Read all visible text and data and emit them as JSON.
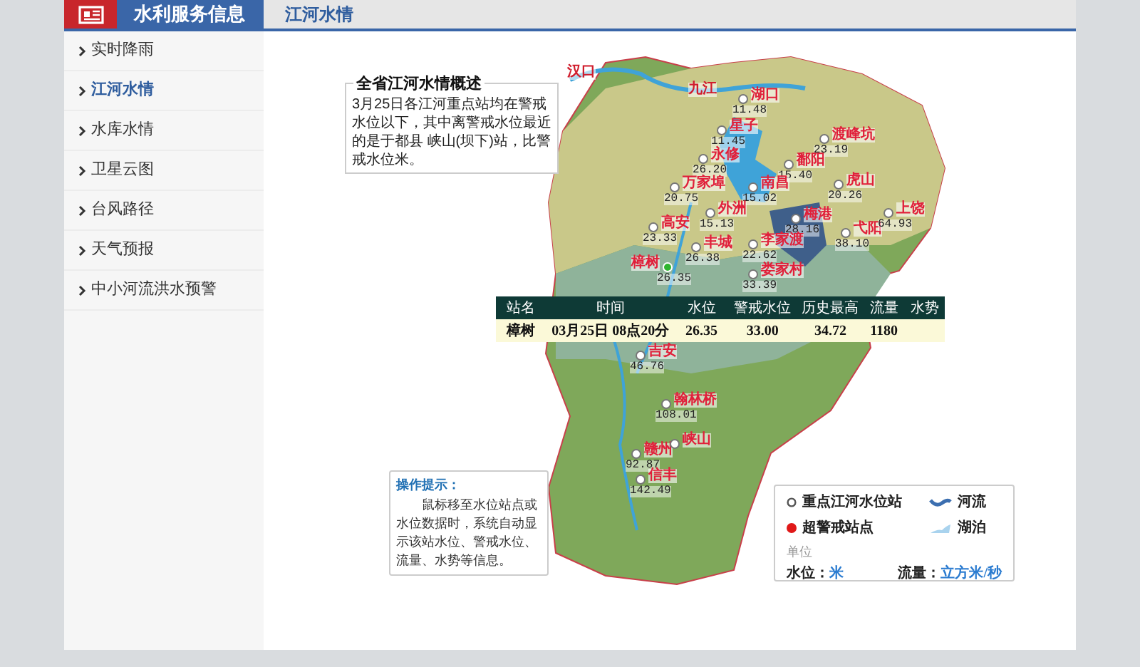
{
  "header": {
    "title": "水利服务信息",
    "tab": "江河水情"
  },
  "sidebar": {
    "items": [
      {
        "label": "实时降雨",
        "selected": false
      },
      {
        "label": "江河水情",
        "selected": true
      },
      {
        "label": "水库水情",
        "selected": false
      },
      {
        "label": "卫星云图",
        "selected": false
      },
      {
        "label": "台风路径",
        "selected": false
      },
      {
        "label": "天气预报",
        "selected": false
      },
      {
        "label": "中小河流洪水预警",
        "selected": false
      }
    ]
  },
  "summary": {
    "title": "全省江河水情概述",
    "text": "3月25日各江河重点站均在警戒水位以下，其中离警戒水位最近的是于都县 峡山(坝下)站，比警戒水位米。"
  },
  "map": {
    "places": [
      "汉口",
      "九江"
    ],
    "stations": [
      {
        "name": "湖口",
        "value": "11.48",
        "selected": false
      },
      {
        "name": "星子",
        "value": "11.45",
        "selected": false
      },
      {
        "name": "渡峰坑",
        "value": "23.19",
        "selected": false
      },
      {
        "name": "永修",
        "value": "26.20",
        "selected": false
      },
      {
        "name": "鄱阳",
        "value": "15.40",
        "selected": false
      },
      {
        "name": "万家埠",
        "value": "20.75",
        "selected": false
      },
      {
        "name": "南昌",
        "value": "15.02",
        "selected": false
      },
      {
        "name": "虎山",
        "value": "20.26",
        "selected": false
      },
      {
        "name": "外洲",
        "value": "15.13",
        "selected": false
      },
      {
        "name": "高安",
        "value": "23.33",
        "selected": false
      },
      {
        "name": "梅港",
        "value": "28.16",
        "selected": false
      },
      {
        "name": "弋阳",
        "value": "38.10",
        "selected": false
      },
      {
        "name": "上饶",
        "value": "64.93",
        "selected": false
      },
      {
        "name": "丰城",
        "value": "26.38",
        "selected": false
      },
      {
        "name": "李家渡",
        "value": "22.62",
        "selected": false
      },
      {
        "name": "樟树",
        "value": "26.35",
        "selected": true
      },
      {
        "name": "娄家村",
        "value": "33.39",
        "selected": false
      },
      {
        "name": "吉安",
        "value": "46.76",
        "selected": false
      },
      {
        "name": "翰林桥",
        "value": "108.01",
        "selected": false
      },
      {
        "name": "赣州",
        "value": "92.87",
        "selected": false
      },
      {
        "name": "峡山",
        "selected": false
      },
      {
        "name": "信丰",
        "value": "142.49",
        "selected": false
      }
    ]
  },
  "table": {
    "columns": [
      "站名",
      "时间",
      "水位",
      "警戒水位",
      "历史最高",
      "流量",
      "水势"
    ],
    "rows": [
      [
        "樟树",
        "03月25日 08点20分",
        "26.35",
        "33.00",
        "34.72",
        "1180"
      ]
    ]
  },
  "tip": {
    "title": "操作提示：",
    "text": "鼠标移至水位站点或水位数据时，系统自动显示该站水位、警戒水位、流量、水势等信息。"
  },
  "legend": {
    "items": [
      {
        "kind": "station",
        "label": "重点江河水位站"
      },
      {
        "kind": "river",
        "label": "河流"
      },
      {
        "kind": "alert",
        "label": "超警戒站点"
      },
      {
        "kind": "lake",
        "label": "湖泊"
      }
    ],
    "unit_title": "单位",
    "units": [
      {
        "label": "水位：",
        "value": "米"
      },
      {
        "label": "流量：",
        "value": "立方米/秒"
      }
    ]
  }
}
